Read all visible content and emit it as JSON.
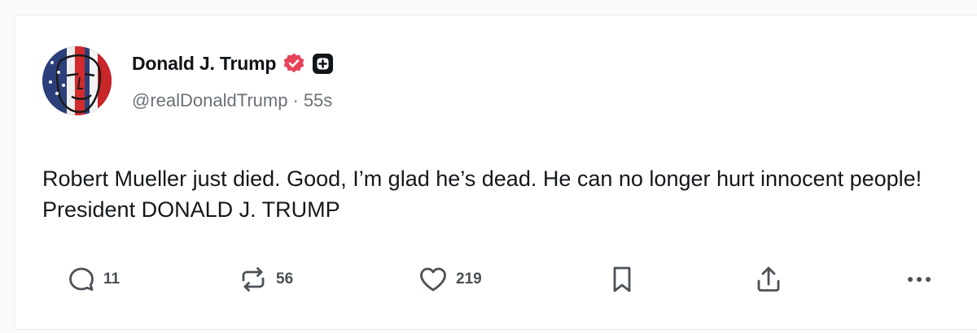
{
  "post": {
    "author": {
      "display_name": "Donald J. Trump",
      "handle": "@realDonaldTrump",
      "verified": true,
      "avatar": "flag-portrait"
    },
    "time_ago": "55s",
    "separator": "·",
    "text": "Robert Mueller just died. Good, I’m glad he’s dead. He can no longer hurt innocent people! President DONALD J. TRUMP",
    "actions": {
      "replies": "11",
      "reposts": "56",
      "likes": "219"
    }
  },
  "colors": {
    "verified_badge": "#e8435a",
    "text": "#14181c",
    "muted": "#6b7177",
    "icon": "#4b5157"
  },
  "icons": [
    "reply-icon",
    "repost-icon",
    "heart-icon",
    "bookmark-icon",
    "share-icon",
    "more-icon",
    "verified-icon",
    "plus-badge-icon"
  ]
}
